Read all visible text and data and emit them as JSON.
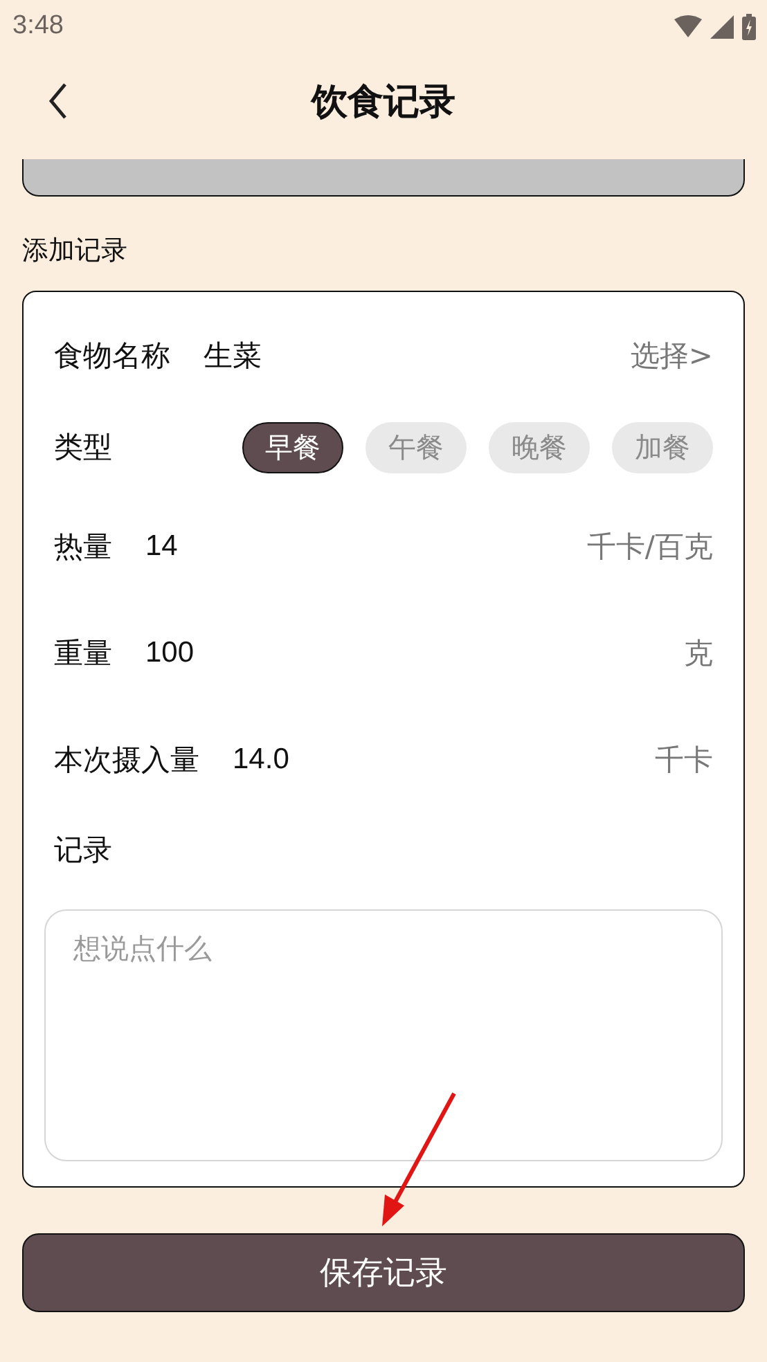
{
  "status_bar": {
    "time": "3:48"
  },
  "header": {
    "title": "饮食记录"
  },
  "section_label": "添加记录",
  "form": {
    "food": {
      "label": "食物名称",
      "value": "生菜",
      "action": "选择>"
    },
    "meal_type": {
      "label": "类型",
      "options": [
        {
          "label": "早餐",
          "selected": true
        },
        {
          "label": "午餐",
          "selected": false
        },
        {
          "label": "晚餐",
          "selected": false
        },
        {
          "label": "加餐",
          "selected": false
        }
      ]
    },
    "fields": [
      {
        "label": "热量",
        "value": "14",
        "unit": "千卡/百克"
      },
      {
        "label": "重量",
        "value": "100",
        "unit": "克"
      },
      {
        "label": "本次摄入量",
        "value": "14.0",
        "unit": "千卡"
      }
    ],
    "note": {
      "label": "记录",
      "placeholder": "想说点什么"
    }
  },
  "save_button": "保存记录"
}
